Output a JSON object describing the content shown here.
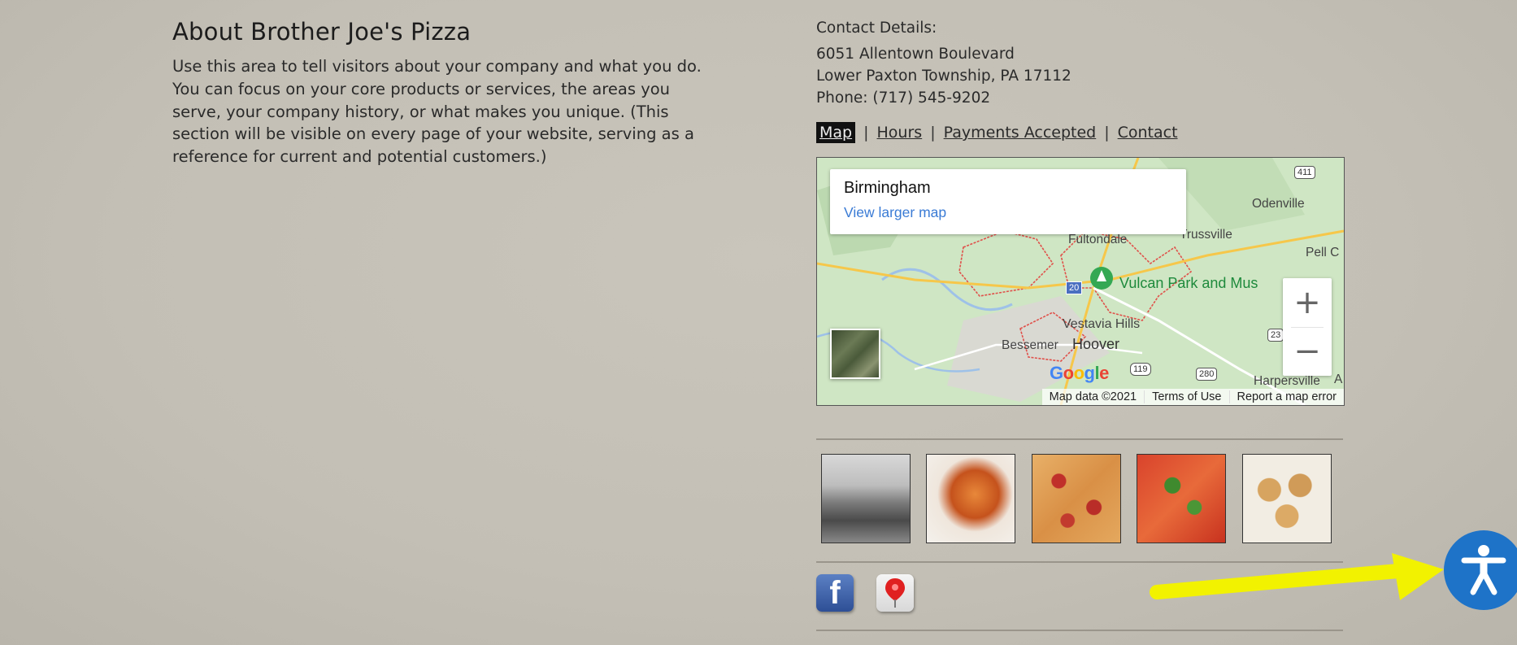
{
  "about": {
    "title": "About Brother Joe's Pizza",
    "body": "Use this area to tell visitors about your company and what you do. You can focus on your core products or services, the areas you serve, your company history, or what makes you unique. (This section will be visible on every page of your website, serving as a reference for current and potential customers.)"
  },
  "contact": {
    "heading": "Contact Details:",
    "street": "6051 Allentown Boulevard",
    "city": "Lower Paxton Township, PA 17112",
    "phone": "Phone: (717) 545-9202"
  },
  "tabs": {
    "map": "Map",
    "hours": "Hours",
    "payments": "Payments Accepted",
    "contact": "Contact",
    "separator": "|",
    "active": "Map"
  },
  "map": {
    "place_name": "Birmingham",
    "view_larger": "View larger map",
    "zoom_in": "+",
    "zoom_out": "−",
    "attribution": "Map data ©2021",
    "terms": "Terms of Use",
    "report": "Report a map error",
    "logo": "Google",
    "labels": {
      "fultondale": "Fultondale",
      "trussville": "Trussville",
      "odenville": "Odenville",
      "pell": "Pell C",
      "vulcan": "Vulcan Park and Mus",
      "vestavia": "Vestavia Hills",
      "bessemer": "Bessemer",
      "hoover": "Hoover",
      "harpersville": "Harpersville",
      "a": "A"
    },
    "shields": {
      "i20": "20",
      "us411": "411",
      "us119": "119",
      "us280": "280",
      "r23": "23"
    }
  },
  "gallery": {
    "items": [
      "venice-canal-photo",
      "pizza-slice-photo",
      "pepperoni-pizza-photo",
      "vegetable-pizza-photo",
      "pizza-rolls-photo"
    ]
  },
  "social": {
    "facebook_glyph": "f",
    "icons": [
      "facebook-icon",
      "map-pin-icon"
    ]
  },
  "accessibility": {
    "icon": "accessibility-icon",
    "color": "#1e73c8"
  },
  "colors": {
    "arrow": "#f2f200",
    "map_water": "#9ec1e8",
    "map_green": "#cde6c2",
    "boundary": "#e0504a"
  }
}
